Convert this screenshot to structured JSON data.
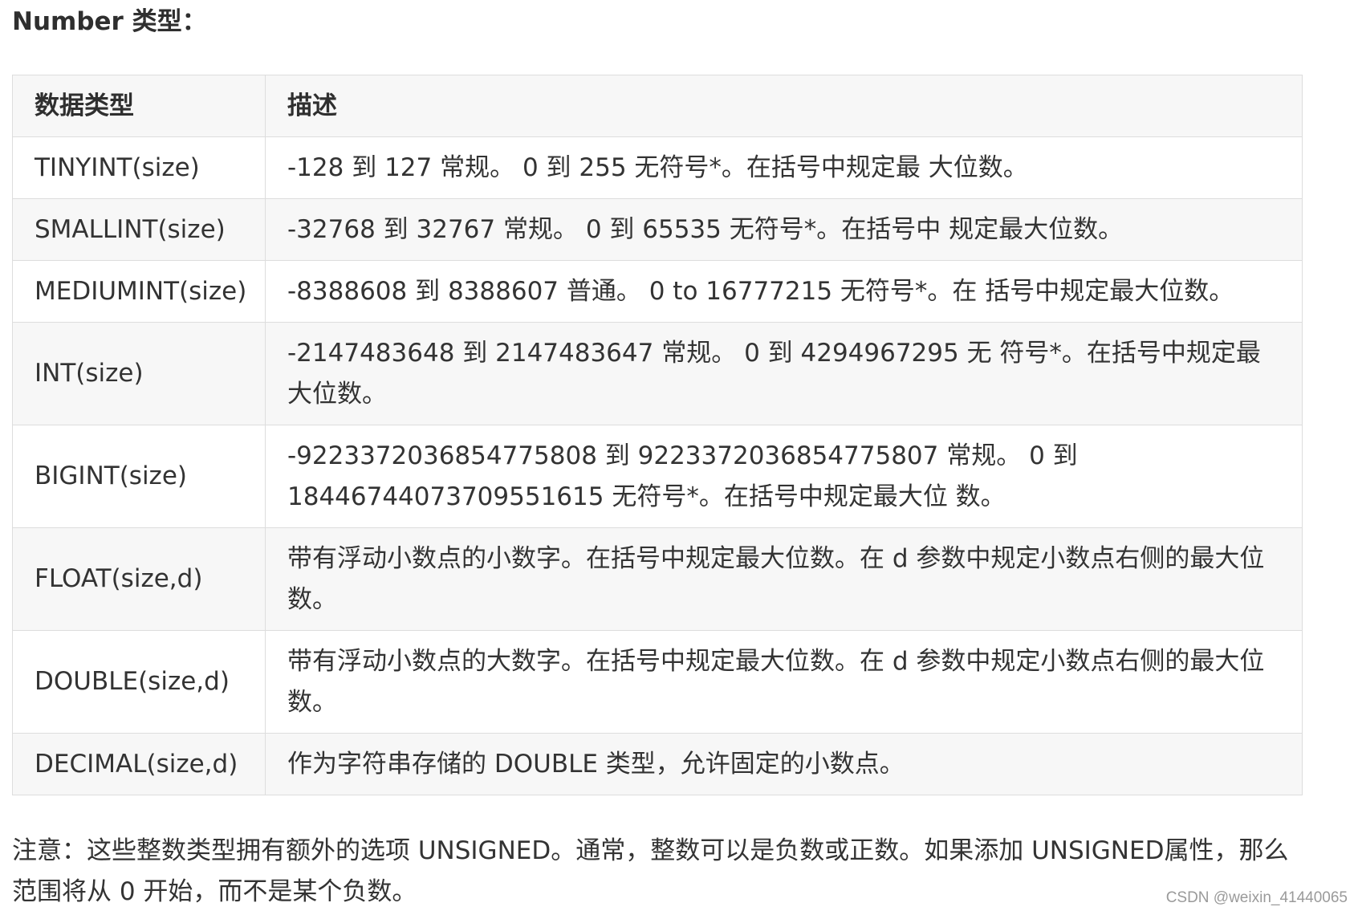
{
  "heading": "Number 类型：",
  "table": {
    "headers": [
      "数据类型",
      "描述"
    ],
    "rows": [
      {
        "type": "TINYINT(size)",
        "desc": "-128 到 127 常规。 0 到 255 无符号*。在括号中规定最 大位数。"
      },
      {
        "type": "SMALLINT(size)",
        "desc": "-32768 到 32767 常规。 0 到 65535 无符号*。在括号中 规定最大位数。"
      },
      {
        "type": "MEDIUMINT(size)",
        "desc": "-8388608 到 8388607 普通。 0 to 16777215 无符号*。在 括号中规定最大位数。"
      },
      {
        "type": "INT(size)",
        "desc": "-2147483648 到 2147483647 常规。 0 到 4294967295 无 符号*。在括号中规定最大位数。"
      },
      {
        "type": "BIGINT(size)",
        "desc": "-9223372036854775808 到 9223372036854775807 常规。 0 到 18446744073709551615 无符号*。在括号中规定最大位 数。"
      },
      {
        "type": "FLOAT(size,d)",
        "desc": "带有浮动小数点的小数字。在括号中规定最大位数。在 d 参数中规定小数点右侧的最大位数。"
      },
      {
        "type": "DOUBLE(size,d)",
        "desc": "带有浮动小数点的大数字。在括号中规定最大位数。在 d 参数中规定小数点右侧的最大位数。"
      },
      {
        "type": "DECIMAL(size,d)",
        "desc": "作为字符串存储的 DOUBLE 类型，允许固定的小数点。"
      }
    ]
  },
  "note": "注意：这些整数类型拥有额外的选项 UNSIGNED。通常，整数可以是负数或正数。如果添加 UNSIGNED属性，那么范围将从 0 开始，而不是某个负数。",
  "watermark": "CSDN @weixin_41440065"
}
